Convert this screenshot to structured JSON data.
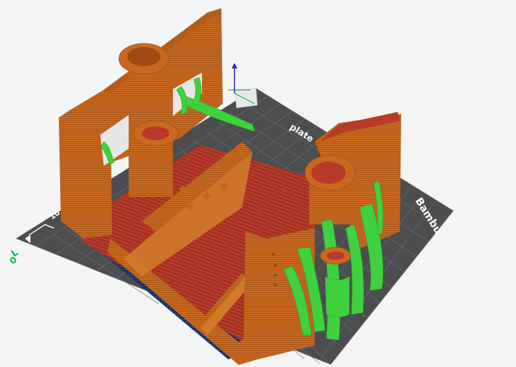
{
  "viewport": {
    "title": "",
    "background_color": "#f3f4f4"
  },
  "build_plate": {
    "color": "#4b4d4f",
    "grid_color": "#6a6d70",
    "brand_text": "Bambu",
    "brand_text_2": "plate",
    "origin_label": "0",
    "axis_tick_label": "10"
  },
  "axis_gizmo": {
    "z_axis_color": "#1a2ec2",
    "x_axis_color": "#13b54a"
  },
  "model": {
    "wall_color": "#c9691f",
    "wall_shadow_color": "#a85619",
    "infill_color": "#b83a2a",
    "support_color": "#3fd13f",
    "first_layer_color": "#16325f"
  }
}
